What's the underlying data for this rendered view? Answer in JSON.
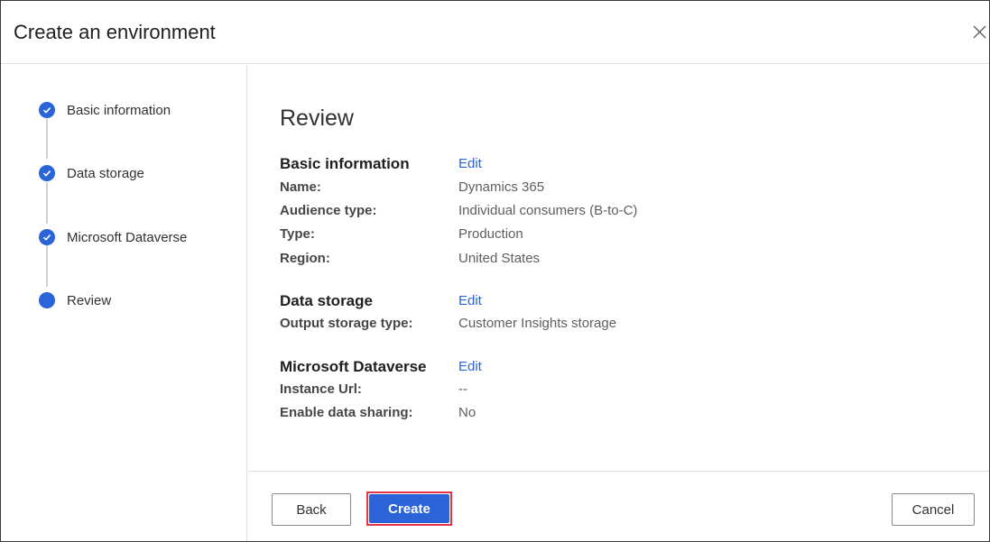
{
  "dialog": {
    "title": "Create an environment",
    "close_icon": "close-icon"
  },
  "steps": [
    {
      "label": "Basic information",
      "status": "completed"
    },
    {
      "label": "Data storage",
      "status": "completed"
    },
    {
      "label": "Microsoft Dataverse",
      "status": "completed"
    },
    {
      "label": "Review",
      "status": "current"
    }
  ],
  "review": {
    "title": "Review",
    "edit_label": "Edit",
    "basic": {
      "title": "Basic information",
      "rows": [
        {
          "label": "Name:",
          "value": "Dynamics 365"
        },
        {
          "label": "Audience type:",
          "value": "Individual consumers (B-to-C)"
        },
        {
          "label": "Type:",
          "value": "Production"
        },
        {
          "label": "Region:",
          "value": "United States"
        }
      ]
    },
    "storage": {
      "title": "Data storage",
      "rows": [
        {
          "label": "Output storage type:",
          "value": "Customer Insights storage"
        }
      ]
    },
    "dataverse": {
      "title": "Microsoft Dataverse",
      "rows": [
        {
          "label": "Instance Url:",
          "value": "--"
        },
        {
          "label": "Enable data sharing:",
          "value": "No"
        }
      ]
    }
  },
  "footer": {
    "back_label": "Back",
    "create_label": "Create",
    "cancel_label": "Cancel"
  },
  "colors": {
    "accent": "#2b63d9",
    "highlight_border": "#e0354a"
  }
}
